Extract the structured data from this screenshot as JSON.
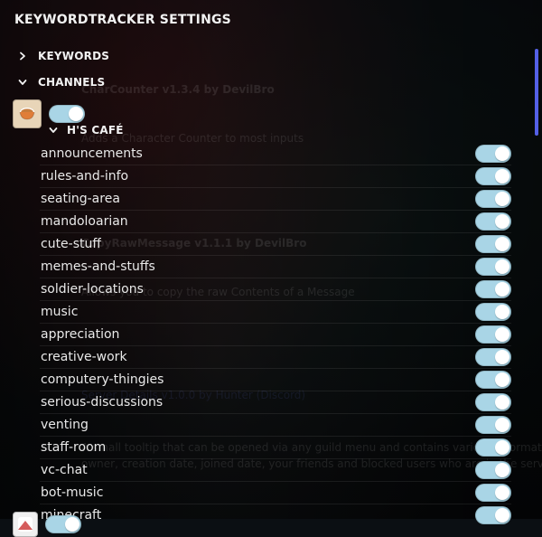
{
  "header": {
    "title": "KEYWORDTRACKER SETTINGS"
  },
  "sections": {
    "keywords_label": "KEYWORDS",
    "channels_label": "CHANNELS",
    "keywords_expanded": false,
    "channels_expanded": true
  },
  "server": {
    "name": "H'S CAFÉ",
    "enabled": true,
    "icon": "cup-icon"
  },
  "channels": [
    {
      "name": "announcements",
      "enabled": true
    },
    {
      "name": "rules-and-info",
      "enabled": true
    },
    {
      "name": "seating-area",
      "enabled": true
    },
    {
      "name": "mandoloarian",
      "enabled": true
    },
    {
      "name": "cute-stuff",
      "enabled": true
    },
    {
      "name": "memes-and-stuffs",
      "enabled": true
    },
    {
      "name": "soldier-locations",
      "enabled": true
    },
    {
      "name": "music",
      "enabled": true
    },
    {
      "name": "appreciation",
      "enabled": true
    },
    {
      "name": "creative-work",
      "enabled": true
    },
    {
      "name": "computery-thingies",
      "enabled": true
    },
    {
      "name": "serious-discussions",
      "enabled": true
    },
    {
      "name": "venting",
      "enabled": true
    },
    {
      "name": "staff-room",
      "enabled": true
    },
    {
      "name": "vc-chat",
      "enabled": true
    },
    {
      "name": "bot-music",
      "enabled": true
    },
    {
      "name": "minecraft",
      "enabled": true
    }
  ],
  "next_server": {
    "enabled": true,
    "icon": "server-avatar-icon"
  },
  "colors": {
    "toggle_on": "#a9d5e6",
    "toggle_off": "#4f545c",
    "scroll_thumb": "#5865f2"
  }
}
